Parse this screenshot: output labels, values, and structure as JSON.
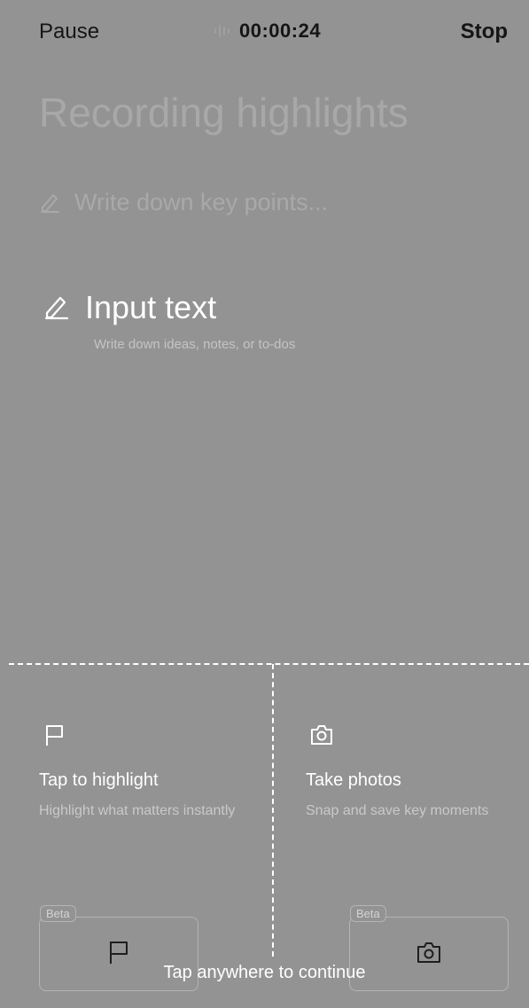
{
  "header": {
    "pause_label": "Pause",
    "timer": "00:00:24",
    "stop_label": "Stop"
  },
  "page": {
    "title": "Recording highlights",
    "key_points_placeholder": "Write down key points..."
  },
  "input_text": {
    "title": "Input text",
    "subtitle": "Write down ideas, notes, or to-dos"
  },
  "features": [
    {
      "icon": "flag-icon",
      "title": "Tap to highlight",
      "description": "Highlight what matters instantly",
      "badge": "Beta"
    },
    {
      "icon": "camera-icon",
      "title": "Take photos",
      "description": "Snap and save key moments",
      "badge": "Beta"
    }
  ],
  "overlay": {
    "continue_label": "Tap anywhere to continue"
  },
  "colors": {
    "overlay_background": "#939393",
    "highlight_text": "#ffffff"
  }
}
